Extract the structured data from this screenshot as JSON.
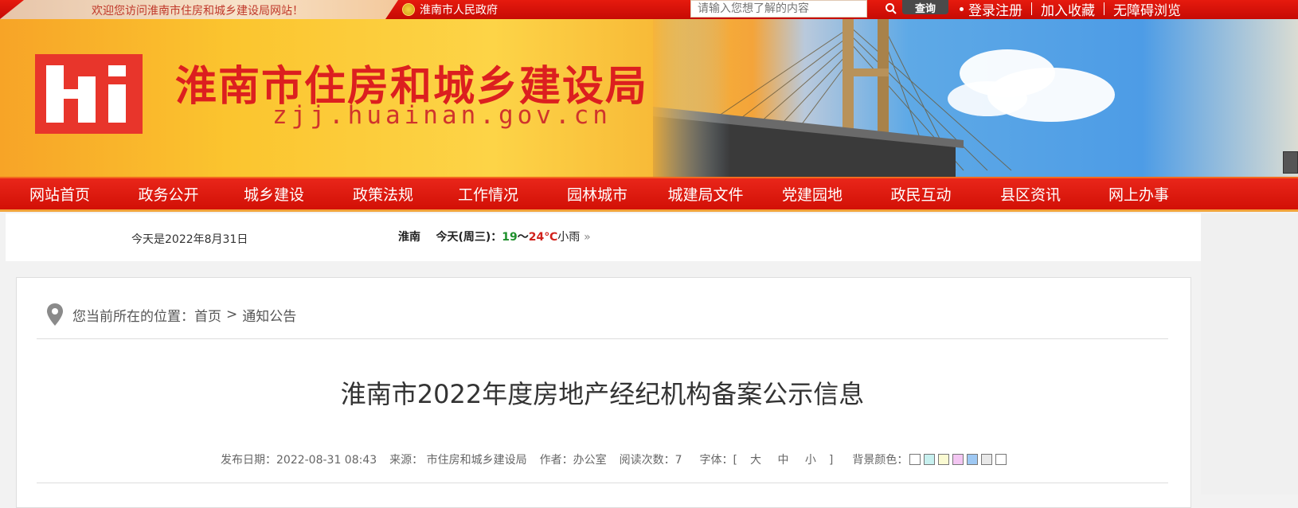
{
  "topbar": {
    "welcome": "欢迎您访问淮南市住房和城乡建设局网站！",
    "gov_link": "淮南市人民政府",
    "search_placeholder": "请输入您想了解的内容",
    "search_button": "查询",
    "links": [
      "登录注册",
      "加入收藏",
      "无障碍浏览"
    ]
  },
  "header": {
    "title": "淮南市住房和城乡建设局",
    "domain": "zjj.huainan.gov.cn"
  },
  "nav": {
    "items": [
      "网站首页",
      "政务公开",
      "城乡建设",
      "政策法规",
      "工作情况",
      "园林城市",
      "城建局文件",
      "党建园地",
      "政民互动",
      "县区资讯",
      "网上办事"
    ]
  },
  "infobar": {
    "date": "今天是2022年8月31日",
    "city": "淮南",
    "today": "今天(周三)：",
    "low": "19",
    "tilde": "～",
    "high": "24℃",
    "condition": "小雨",
    "more": "»"
  },
  "breadcrumb": {
    "prefix": "您当前所在的位置：",
    "home": "首页",
    "sep": ">",
    "current": "通知公告"
  },
  "article": {
    "title": "淮南市2022年度房地产经纪机构备案公示信息",
    "publish_date": "发布日期：2022-08-31 08:43",
    "source": "来源： 市住房和城乡建设局",
    "author": "作者：办公室",
    "reads": "阅读次数：7",
    "font_label": "字体：[",
    "font_large": "大",
    "font_medium": "中",
    "font_small": "小",
    "font_close": "]",
    "bg_label": "背景颜色："
  },
  "bg_colors": [
    "#ffffff",
    "#c7f0ef",
    "#fafad2",
    "#f3c6f2",
    "#9ec8f3",
    "#e8e8e8",
    "#ffffff"
  ],
  "colors": {
    "brand_red": "#dc1f1f",
    "nav_red": "#e9261a"
  }
}
